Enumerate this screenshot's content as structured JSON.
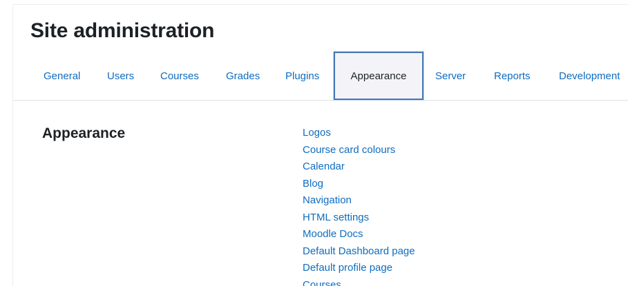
{
  "header": {
    "title": "Site administration"
  },
  "tabs": [
    {
      "label": "General"
    },
    {
      "label": "Users"
    },
    {
      "label": "Courses"
    },
    {
      "label": "Grades"
    },
    {
      "label": "Plugins"
    },
    {
      "label": "Appearance",
      "active": true
    },
    {
      "label": "Server"
    },
    {
      "label": "Reports"
    },
    {
      "label": "Development"
    }
  ],
  "section": {
    "title": "Appearance",
    "links": [
      "Logos",
      "Course card colours",
      "Calendar",
      "Blog",
      "Navigation",
      "HTML settings",
      "Moodle Docs",
      "Default Dashboard page",
      "Default profile page",
      "Courses"
    ]
  },
  "colors": {
    "link": "#0f6cbf",
    "text": "#1d2125",
    "active_tab_border": "#4478b3",
    "active_tab_bg": "#f4f4f8"
  }
}
